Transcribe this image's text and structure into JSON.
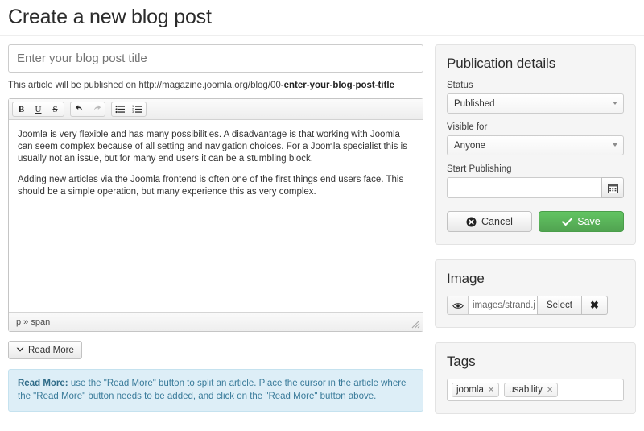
{
  "header": {
    "title": "Create a new blog post"
  },
  "form": {
    "title_placeholder": "Enter your blog post title",
    "title_value": "",
    "permalink_prefix": "This article will be published on http://magazine.joomla.org/blog/00-",
    "permalink_slug": "enter-your-blog-post-title"
  },
  "editor": {
    "toolbar": [
      {
        "name": "bold-button",
        "label": "B",
        "icon": "bold-icon"
      },
      {
        "name": "underline-button",
        "label": "U",
        "icon": "underline-icon"
      },
      {
        "name": "strikethrough-button",
        "label": "S",
        "icon": "strikethrough-icon"
      },
      {
        "name": "undo-button",
        "label": "",
        "icon": "undo-arrow-icon"
      },
      {
        "name": "redo-button",
        "label": "",
        "icon": "redo-arrow-icon"
      },
      {
        "name": "bullet-list-button",
        "label": "",
        "icon": "unordered-list-icon"
      },
      {
        "name": "numbered-list-button",
        "label": "",
        "icon": "ordered-list-icon"
      }
    ],
    "paragraphs": [
      "Joomla is very flexible and has many possibilities. A disadvantage is that working with Joomla can seem complex because of all setting and navigation choices. For a Joomla specialist this is usually not an issue, but for many end users it can be a stumbling block.",
      "Adding new articles via the Joomla frontend is often one of the first things end users face. This should be a simple operation, but many experience this as very complex."
    ],
    "status_path": "p » span"
  },
  "readmore": {
    "button_label": "Read More",
    "button_icon": "caret-down-icon",
    "alert_strong": "Read More:",
    "alert_text": " use the \"Read More\" button to split an article. Place the cursor in the article where the \"Read More\" button needs to be added, and click on the \"Read More\" button above."
  },
  "publication": {
    "panel_title": "Publication details",
    "status_label": "Status",
    "status_value": "Published",
    "visible_label": "Visible for",
    "visible_value": "Anyone",
    "start_label": "Start Publishing",
    "start_value": "",
    "calendar_icon": "calendar-icon",
    "cancel_label": "Cancel",
    "cancel_icon": "cancel-circle-icon",
    "save_label": "Save",
    "save_icon": "check-icon"
  },
  "image": {
    "panel_title": "Image",
    "eye_icon": "eye-icon",
    "path_value": "images/strand.j",
    "select_label": "Select",
    "clear_icon": "close-x-icon",
    "clear_label": "✖"
  },
  "tags": {
    "panel_title": "Tags",
    "items": [
      {
        "label": "joomla",
        "remove": "✕"
      },
      {
        "label": "usability",
        "remove": "✕"
      }
    ]
  },
  "colors": {
    "save_green": "#51a351",
    "alert_bg": "#ddeef7",
    "alert_text": "#3a7b9a",
    "panel_bg": "#f5f5f5"
  }
}
